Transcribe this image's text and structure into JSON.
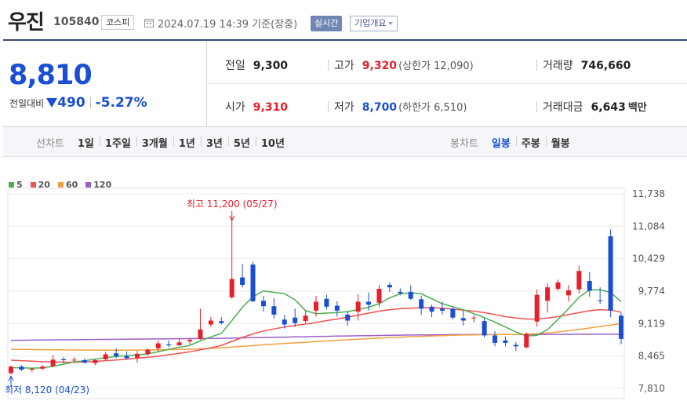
{
  "header": {
    "name": "우진",
    "code": "105840",
    "market": "코스피",
    "datetime": "2024.07.19 14:39 기준(장중)",
    "realtime_button": "실시간",
    "company_button": "기업개요"
  },
  "quote": {
    "price": "8,810",
    "change_label": "전일대비",
    "change": "490",
    "change_pct": "-5.27%",
    "prev_close_label": "전일",
    "prev_close": "9,300",
    "high_label": "고가",
    "high": "9,320",
    "upper_limit_label": "(상한가 12,090)",
    "volume_label": "거래량",
    "volume": "746,660",
    "open_label": "시가",
    "open": "9,310",
    "low_label": "저가",
    "low": "8,700",
    "lower_limit_label": "(하한가 6,510)",
    "amount_label": "거래대금",
    "amount": "6,643",
    "amount_unit": "백만"
  },
  "periods": {
    "line_label": "선차트",
    "line_items": [
      "1일",
      "1주일",
      "3개월",
      "1년",
      "3년",
      "5년",
      "10년"
    ],
    "candle_label": "봉차트",
    "candle_items": [
      "일봉",
      "주봉",
      "월봉"
    ],
    "candle_selected": 0
  },
  "colors": {
    "up": "#e5202c",
    "down": "#1a4fd4",
    "ma5": "#4caf50",
    "ma20": "#ef5350",
    "ma60": "#f0a040",
    "ma120": "#9c5fc9"
  },
  "chart_data": {
    "type": "candlestick",
    "legend": [
      {
        "name": "5",
        "color": "#4caf50"
      },
      {
        "name": "20",
        "color": "#ef5350"
      },
      {
        "name": "60",
        "color": "#f0a040"
      },
      {
        "name": "120",
        "color": "#9c5fc9"
      }
    ],
    "y_ticks": [
      "11,738",
      "11,084",
      "10,429",
      "9,774",
      "9,119",
      "8,465",
      "7,810"
    ],
    "ylim": [
      7810,
      11738
    ],
    "annotations": {
      "max_label": "최고 11,200 (05/27)",
      "min_label": "최저 8,120 (04/23)"
    },
    "candles": [
      [
        8120,
        8270,
        8090,
        8250
      ],
      [
        8250,
        8280,
        8160,
        8190
      ],
      [
        8190,
        8220,
        8140,
        8210
      ],
      [
        8210,
        8280,
        8180,
        8250
      ],
      [
        8260,
        8480,
        8240,
        8390
      ],
      [
        8400,
        8440,
        8320,
        8380
      ],
      [
        8380,
        8440,
        8330,
        8390
      ],
      [
        8380,
        8420,
        8310,
        8330
      ],
      [
        8320,
        8410,
        8280,
        8380
      ],
      [
        8400,
        8550,
        8380,
        8500
      ],
      [
        8520,
        8620,
        8420,
        8460
      ],
      [
        8460,
        8560,
        8400,
        8420
      ],
      [
        8430,
        8570,
        8330,
        8510
      ],
      [
        8500,
        8620,
        8470,
        8590
      ],
      [
        8620,
        8780,
        8560,
        8720
      ],
      [
        8700,
        8780,
        8640,
        8680
      ],
      [
        8680,
        8820,
        8670,
        8740
      ],
      [
        8760,
        8830,
        8700,
        8790
      ],
      [
        8810,
        9420,
        8790,
        9000
      ],
      [
        9100,
        9250,
        9050,
        9180
      ],
      [
        9170,
        9250,
        9100,
        9130
      ],
      [
        9650,
        11200,
        9620,
        10020
      ],
      [
        10050,
        10320,
        9850,
        9900
      ],
      [
        10310,
        10370,
        9550,
        9570
      ],
      [
        9580,
        9680,
        9360,
        9470
      ],
      [
        9470,
        9630,
        9220,
        9300
      ],
      [
        9200,
        9290,
        9020,
        9100
      ],
      [
        9240,
        9420,
        9050,
        9130
      ],
      [
        9170,
        9370,
        9130,
        9280
      ],
      [
        9380,
        9680,
        9260,
        9560
      ],
      [
        9620,
        9700,
        9400,
        9460
      ],
      [
        9480,
        9570,
        9260,
        9380
      ],
      [
        9300,
        9360,
        9080,
        9180
      ],
      [
        9360,
        9710,
        9180,
        9560
      ],
      [
        9560,
        9750,
        9380,
        9500
      ],
      [
        9540,
        9900,
        9450,
        9820
      ],
      [
        9900,
        9950,
        9760,
        9850
      ],
      [
        9760,
        9830,
        9690,
        9730
      ],
      [
        9760,
        9890,
        9600,
        9620
      ],
      [
        9610,
        9680,
        9300,
        9420
      ],
      [
        9460,
        9500,
        9250,
        9360
      ],
      [
        9420,
        9560,
        9300,
        9380
      ],
      [
        9420,
        9460,
        9200,
        9240
      ],
      [
        9230,
        9380,
        9080,
        9180
      ],
      [
        9230,
        9290,
        9140,
        9240
      ],
      [
        9170,
        9230,
        8840,
        8880
      ],
      [
        8880,
        8970,
        8660,
        8730
      ],
      [
        8780,
        8860,
        8660,
        8730
      ],
      [
        8690,
        8750,
        8570,
        8660
      ],
      [
        8640,
        8940,
        8620,
        8910
      ],
      [
        9160,
        9810,
        9060,
        9700
      ],
      [
        9580,
        9930,
        9340,
        9850
      ],
      [
        9820,
        10010,
        9780,
        9950
      ],
      [
        9690,
        9900,
        9560,
        9790
      ],
      [
        9810,
        10290,
        9730,
        10180
      ],
      [
        9980,
        10160,
        9660,
        9780
      ],
      [
        9590,
        9850,
        9520,
        9580
      ],
      [
        10880,
        11020,
        9250,
        9380
      ],
      [
        9280,
        9340,
        8700,
        8810
      ]
    ],
    "ma5": [
      8230,
      8225,
      8220,
      8226,
      8258,
      8300,
      8345,
      8370,
      8400,
      8432,
      8455,
      8470,
      8488,
      8512,
      8550,
      8600,
      8640,
      8680,
      8770,
      8850,
      8920,
      9180,
      9450,
      9660,
      9780,
      9750,
      9720,
      9600,
      9380,
      9320,
      9330,
      9340,
      9360,
      9400,
      9450,
      9520,
      9640,
      9720,
      9740,
      9720,
      9620,
      9520,
      9460,
      9400,
      9320,
      9240,
      9150,
      9050,
      8950,
      8870,
      8880,
      9000,
      9200,
      9420,
      9650,
      9800,
      9800,
      9750,
      9560
    ],
    "ma20": [
      8380,
      8370,
      8360,
      8350,
      8345,
      8340,
      8340,
      8345,
      8355,
      8370,
      8385,
      8400,
      8420,
      8440,
      8460,
      8490,
      8520,
      8550,
      8590,
      8630,
      8680,
      8760,
      8840,
      8910,
      8970,
      9010,
      9050,
      9080,
      9110,
      9140,
      9180,
      9210,
      9250,
      9290,
      9330,
      9370,
      9400,
      9420,
      9430,
      9440,
      9440,
      9430,
      9410,
      9390,
      9370,
      9340,
      9300,
      9260,
      9230,
      9210,
      9210,
      9230,
      9260,
      9300,
      9340,
      9380,
      9400,
      9390,
      9350
    ],
    "ma60": [
      8600,
      8598,
      8595,
      8592,
      8590,
      8588,
      8586,
      8585,
      8584,
      8583,
      8583,
      8584,
      8585,
      8587,
      8590,
      8593,
      8597,
      8602,
      8610,
      8620,
      8630,
      8645,
      8660,
      8675,
      8690,
      8705,
      8718,
      8730,
      8742,
      8755,
      8768,
      8780,
      8792,
      8804,
      8815,
      8826,
      8836,
      8845,
      8854,
      8862,
      8870,
      8876,
      8882,
      8888,
      8892,
      8895,
      8897,
      8899,
      8900,
      8905,
      8915,
      8930,
      8950,
      8975,
      9000,
      9030,
      9060,
      9090,
      9120
    ],
    "ma120": [
      8780,
      8782,
      8785,
      8787,
      8790,
      8792,
      8794,
      8796,
      8798,
      8800,
      8802,
      8804,
      8806,
      8808,
      8810,
      8812,
      8814,
      8816,
      8818,
      8820,
      8822,
      8826,
      8830,
      8834,
      8838,
      8842,
      8846,
      8850,
      8854,
      8858,
      8862,
      8866,
      8870,
      8873,
      8876,
      8879,
      8882,
      8885,
      8888,
      8890,
      8892,
      8894,
      8896,
      8897,
      8898,
      8899,
      8900,
      8900,
      8900,
      8900,
      8900,
      8901,
      8902,
      8903,
      8904,
      8905,
      8905,
      8904,
      8902
    ]
  }
}
